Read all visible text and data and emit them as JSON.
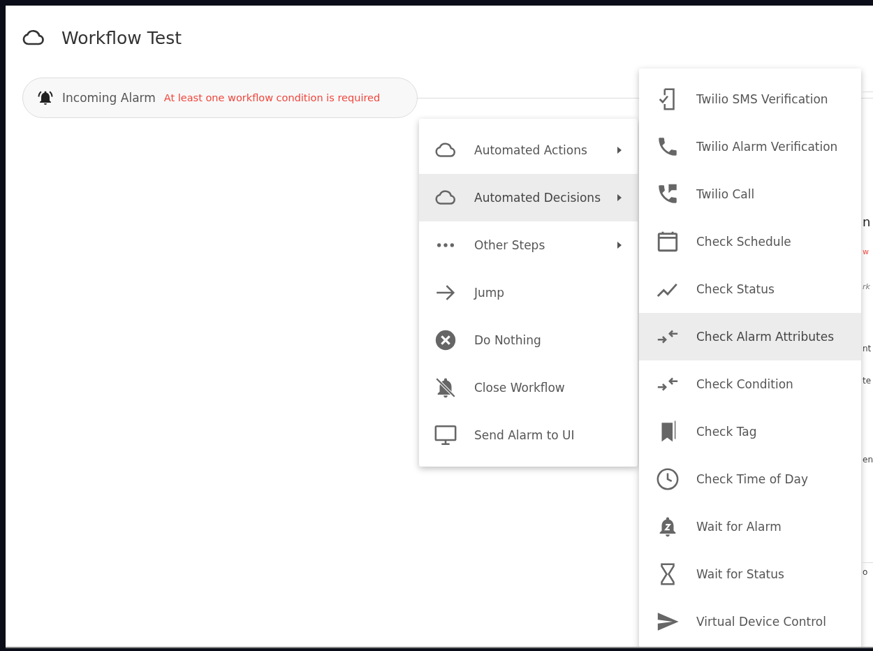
{
  "header": {
    "title": "Workflow Test"
  },
  "trigger": {
    "label": "Incoming Alarm",
    "error": "At least one workflow condition is required"
  },
  "menu": {
    "items": [
      {
        "label": "Automated Actions",
        "submenu": true,
        "selected": false
      },
      {
        "label": "Automated Decisions",
        "submenu": true,
        "selected": true
      },
      {
        "label": "Other Steps",
        "submenu": true,
        "selected": false
      },
      {
        "label": "Jump",
        "submenu": false,
        "selected": false
      },
      {
        "label": "Do Nothing",
        "submenu": false,
        "selected": false
      },
      {
        "label": "Close Workflow",
        "submenu": false,
        "selected": false
      },
      {
        "label": "Send Alarm to UI",
        "submenu": false,
        "selected": false
      }
    ]
  },
  "submenu": {
    "items": [
      {
        "label": "Twilio SMS Verification",
        "selected": false
      },
      {
        "label": "Twilio Alarm Verification",
        "selected": false
      },
      {
        "label": "Twilio Call",
        "selected": false
      },
      {
        "label": "Check Schedule",
        "selected": false
      },
      {
        "label": "Check Status",
        "selected": false
      },
      {
        "label": "Check Alarm Attributes",
        "selected": true
      },
      {
        "label": "Check Condition",
        "selected": false
      },
      {
        "label": "Check Tag",
        "selected": false
      },
      {
        "label": "Check Time of Day",
        "selected": false
      },
      {
        "label": "Wait for Alarm",
        "selected": false
      },
      {
        "label": "Wait for Status",
        "selected": false
      },
      {
        "label": "Virtual Device Control",
        "selected": false
      }
    ]
  },
  "side_panel": {
    "fragments": [
      {
        "text": "n",
        "kind": "heading"
      },
      {
        "text": "w",
        "kind": "error"
      },
      {
        "text": "rk",
        "kind": "hint"
      },
      {
        "text": "nt",
        "kind": "plain"
      },
      {
        "text": "te",
        "kind": "plain"
      },
      {
        "text": "en",
        "kind": "plain"
      },
      {
        "text": "o",
        "kind": "plain"
      }
    ]
  }
}
